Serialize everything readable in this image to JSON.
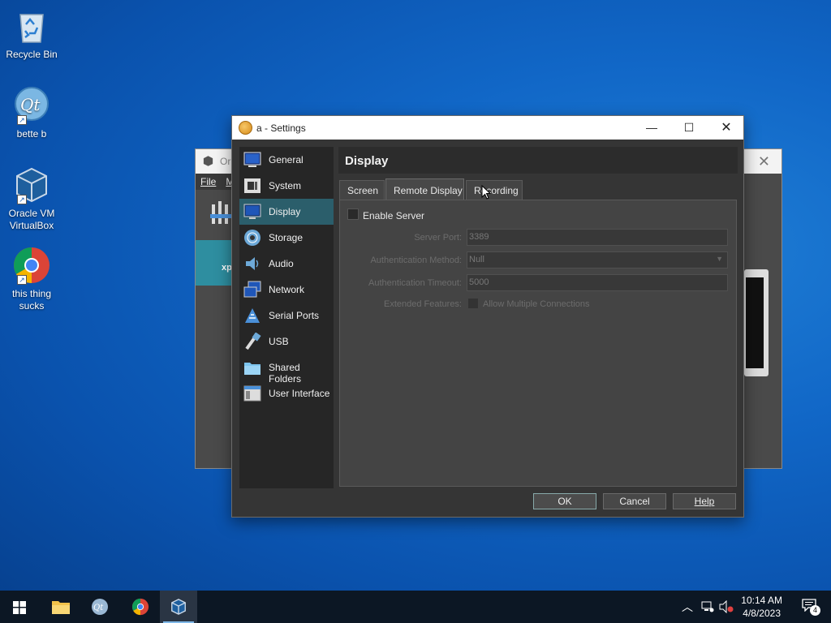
{
  "desktop": {
    "icons": [
      {
        "label": "Recycle Bin",
        "icon": "recycle-bin-icon"
      },
      {
        "label": "bette b",
        "icon": "qt-icon"
      },
      {
        "label": "Oracle VM VirtualBox",
        "icon": "virtualbox-icon"
      },
      {
        "label": "this thing sucks",
        "icon": "chrome-icon"
      }
    ]
  },
  "background_window": {
    "title": "Or",
    "menu": [
      "File",
      "M"
    ],
    "vm_label": "xp"
  },
  "dialog": {
    "title": "a - Settings",
    "window_buttons": {
      "minimize": "—",
      "maximize": "☐",
      "close": "✕"
    },
    "sidebar": [
      {
        "label": "General",
        "icon": "general-icon"
      },
      {
        "label": "System",
        "icon": "system-icon"
      },
      {
        "label": "Display",
        "icon": "display-icon",
        "selected": true
      },
      {
        "label": "Storage",
        "icon": "storage-icon"
      },
      {
        "label": "Audio",
        "icon": "audio-icon"
      },
      {
        "label": "Network",
        "icon": "network-icon"
      },
      {
        "label": "Serial Ports",
        "icon": "serial-ports-icon"
      },
      {
        "label": "USB",
        "icon": "usb-icon"
      },
      {
        "label": "Shared Folders",
        "icon": "shared-folders-icon"
      },
      {
        "label": "User Interface",
        "icon": "user-interface-icon"
      }
    ],
    "page_title": "Display",
    "tabs": [
      "Screen",
      "Remote Display",
      "Recording"
    ],
    "active_tab": "Remote Display",
    "remote_display": {
      "enable_server_label": "Enable Server",
      "enable_server_checked": false,
      "server_port_label": "Server Port:",
      "server_port_value": "3389",
      "auth_method_label": "Authentication Method:",
      "auth_method_value": "Null",
      "auth_timeout_label": "Authentication Timeout:",
      "auth_timeout_value": "5000",
      "extended_features_label": "Extended Features:",
      "allow_multiple_label": "Allow Multiple Connections",
      "allow_multiple_checked": false
    },
    "buttons": {
      "ok": "OK",
      "cancel": "Cancel",
      "help": "Help"
    }
  },
  "taskbar": {
    "items": [
      "start-icon",
      "file-explorer-icon",
      "qt-icon",
      "chrome-icon",
      "virtualbox-icon"
    ],
    "clock_time": "10:14 AM",
    "clock_date": "4/8/2023",
    "notification_count": "4"
  },
  "colors": {
    "desktop_blue": "#1167c7",
    "dialog_bg": "#353535",
    "selection_teal": "#2b5e6b",
    "taskbar": "#0c1724"
  }
}
